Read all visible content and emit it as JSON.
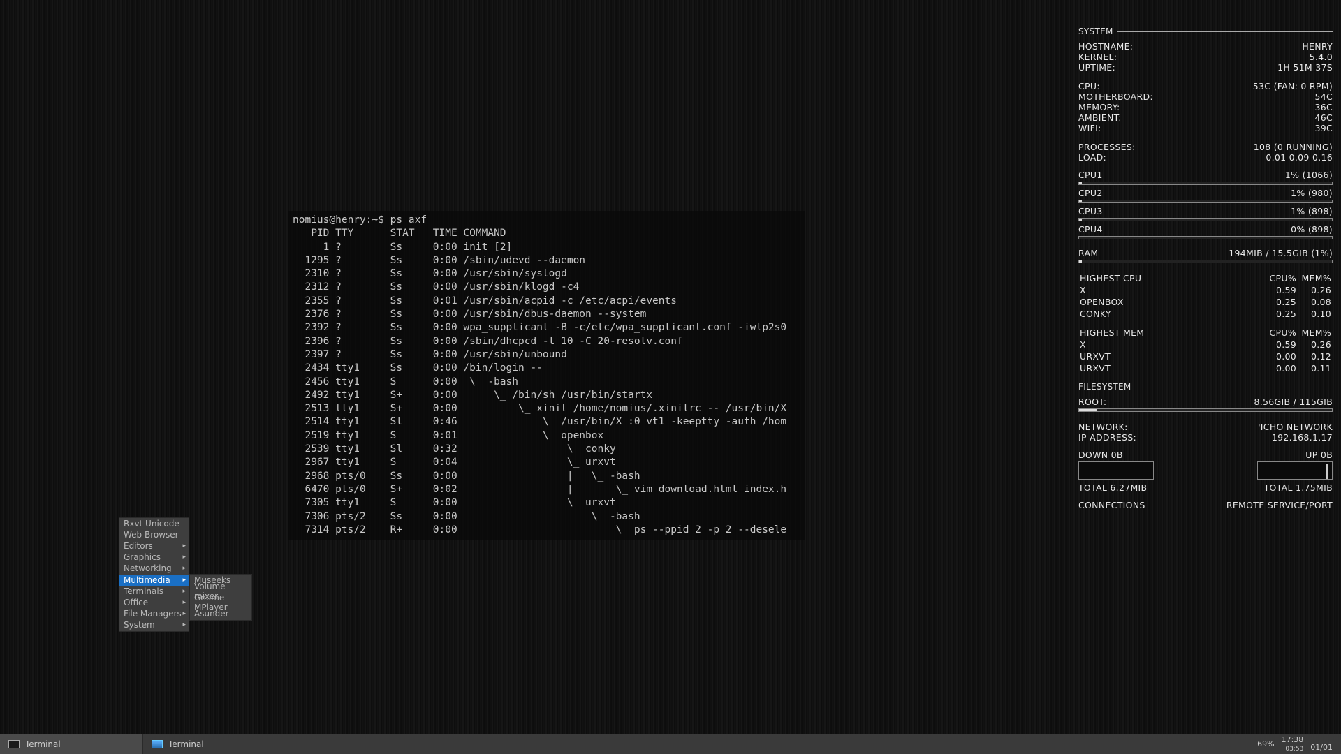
{
  "terminal": {
    "prompt": "nomius@henry:~$ ps axf",
    "header": "   PID TTY      STAT   TIME COMMAND",
    "rows": [
      "     1 ?        Ss     0:00 init [2]",
      "  1295 ?        Ss     0:00 /sbin/udevd --daemon",
      "  2310 ?        Ss     0:00 /usr/sbin/syslogd",
      "  2312 ?        Ss     0:00 /usr/sbin/klogd -c4",
      "  2355 ?        Ss     0:01 /usr/sbin/acpid -c /etc/acpi/events",
      "  2376 ?        Ss     0:00 /usr/sbin/dbus-daemon --system",
      "  2392 ?        Ss     0:00 wpa_supplicant -B -c/etc/wpa_supplicant.conf -iwlp2s0",
      "  2396 ?        Ss     0:00 /sbin/dhcpcd -t 10 -C 20-resolv.conf",
      "  2397 ?        Ss     0:00 /usr/sbin/unbound",
      "  2434 tty1     Ss     0:00 /bin/login --",
      "  2456 tty1     S      0:00  \\_ -bash",
      "  2492 tty1     S+     0:00      \\_ /bin/sh /usr/bin/startx",
      "  2513 tty1     S+     0:00          \\_ xinit /home/nomius/.xinitrc -- /usr/bin/X",
      "  2514 tty1     Sl     0:46              \\_ /usr/bin/X :0 vt1 -keeptty -auth /hom",
      "  2519 tty1     S      0:01              \\_ openbox",
      "  2539 tty1     Sl     0:32                  \\_ conky",
      "  2967 tty1     S      0:04                  \\_ urxvt",
      "  2968 pts/0    Ss     0:00                  |   \\_ -bash",
      "  6470 pts/0    S+     0:02                  |       \\_ vim download.html index.h",
      "  7305 tty1     S      0:00                  \\_ urxvt",
      "  7306 pts/2    Ss     0:00                      \\_ -bash",
      "  7314 pts/2    R+     0:00                          \\_ ps --ppid 2 -p 2 --desele"
    ]
  },
  "menu": {
    "items": [
      {
        "label": "Rxvt Unicode",
        "sub": false
      },
      {
        "label": "Web Browser",
        "sub": false
      },
      {
        "label": "Editors",
        "sub": true
      },
      {
        "label": "Graphics",
        "sub": true
      },
      {
        "label": "Networking",
        "sub": true
      },
      {
        "label": "Multimedia",
        "sub": true,
        "selected": true
      },
      {
        "label": "Terminals",
        "sub": true
      },
      {
        "label": "Office",
        "sub": true
      },
      {
        "label": "File Managers",
        "sub": true
      },
      {
        "label": "System",
        "sub": true
      }
    ],
    "submenu": [
      "Museeks",
      "Volume mixer",
      "Gnome-MPlayer",
      "Asunder"
    ]
  },
  "conky": {
    "system_title": "SYSTEM",
    "hostname_label": "HOSTNAME:",
    "hostname": "HENRY",
    "kernel_label": "KERNEL:",
    "kernel": "5.4.0",
    "uptime_label": "UPTIME:",
    "uptime": "1H 51M 37S",
    "cpu_label": "CPU:",
    "cpu": "53C  (FAN: 0 RPM)",
    "mb_label": "MOTHERBOARD:",
    "mb": "54C",
    "mem_label": "MEMORY:",
    "mem": "36C",
    "amb_label": "AMBIENT:",
    "amb": "46C",
    "wifi_label": "WIFI:",
    "wifi": "39C",
    "proc_label": "PROCESSES:",
    "proc": "108 (0 RUNNING)",
    "load_label": "LOAD:",
    "load": "0.01 0.09 0.16",
    "cpus": [
      {
        "name": "CPU1",
        "val": "1% (1066)",
        "pct": 1
      },
      {
        "name": "CPU2",
        "val": "1% (980)",
        "pct": 1
      },
      {
        "name": "CPU3",
        "val": "1% (898)",
        "pct": 1
      },
      {
        "name": "CPU4",
        "val": "0% (898)",
        "pct": 0
      }
    ],
    "ram_label": "RAM",
    "ram_val": "194MIB / 15.5GIB (1%)",
    "ram_pct": 1,
    "highcpu_title": "HIGHEST CPU",
    "highcpu_hdr_cpu": "CPU%",
    "highcpu_hdr_mem": "MEM%",
    "highcpu": [
      {
        "n": "X",
        "c": "0.59",
        "m": "0.26"
      },
      {
        "n": "OPENBOX",
        "c": "0.25",
        "m": "0.08"
      },
      {
        "n": "CONKY",
        "c": "0.25",
        "m": "0.10"
      }
    ],
    "highmem_title": "HIGHEST MEM",
    "highmem": [
      {
        "n": "X",
        "c": "0.59",
        "m": "0.26"
      },
      {
        "n": "URXVT",
        "c": "0.00",
        "m": "0.12"
      },
      {
        "n": "URXVT",
        "c": "0.00",
        "m": "0.11"
      }
    ],
    "fs_title": "FILESYSTEM",
    "root_label": "ROOT:",
    "root_val": "8.56GIB / 115GIB",
    "root_pct": 7,
    "net_label": "NETWORK:",
    "net_val": "'ICHO NETWORK",
    "ip_label": "IP ADDRESS:",
    "ip_val": "192.168.1.17",
    "down_label": "DOWN 0B",
    "up_label": "UP 0B",
    "down_total": "TOTAL 6.27MIB",
    "up_total": "TOTAL 1.75MIB",
    "conn_title": "CONNECTIONS",
    "conn_hdr": "REMOTE SERVICE/PORT"
  },
  "taskbar": {
    "task1": "Terminal",
    "task2": "Terminal",
    "battery": "69%",
    "time": "17:38",
    "secs": "03:53",
    "date": "01/01"
  }
}
